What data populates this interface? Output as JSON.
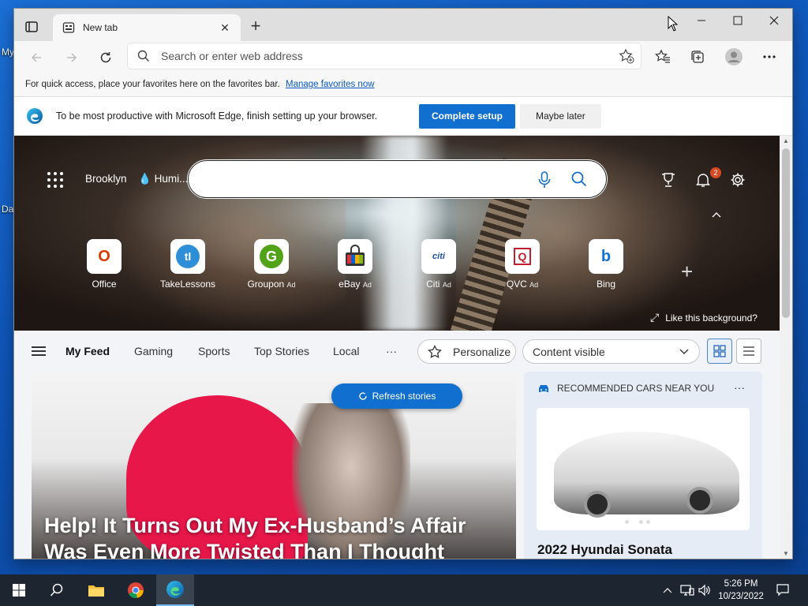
{
  "desktop": {
    "icon_labels": [
      "My",
      "Da"
    ]
  },
  "browser": {
    "tab": {
      "title": "New tab"
    },
    "address": {
      "placeholder": "Search or enter web address"
    },
    "favorites_bar": {
      "text": "For quick access, place your favorites here on the favorites bar.",
      "link": "Manage favorites now"
    },
    "infobar": {
      "message": "To be most productive with Microsoft Edge, finish setting up your browser.",
      "primary": "Complete setup",
      "secondary": "Maybe later"
    }
  },
  "newtab": {
    "location": "Brooklyn",
    "weather": "Humi...",
    "notifications_count": "2",
    "quick_links": [
      {
        "label": "Office",
        "ad": "",
        "color": "#d83b01",
        "glyph": "O"
      },
      {
        "label": "TakeLessons",
        "ad": "",
        "color": "#2e8fd8",
        "glyph": "tl"
      },
      {
        "label": "Groupon",
        "ad": "Ad",
        "color": "#53a318",
        "glyph": "G"
      },
      {
        "label": "eBay",
        "ad": "Ad",
        "color": "#e53238",
        "glyph": "eb"
      },
      {
        "label": "Citi",
        "ad": "Ad",
        "color": "#1b4fa0",
        "glyph": "citi"
      },
      {
        "label": "QVC",
        "ad": "Ad",
        "color": "#c21d2f",
        "glyph": "Q"
      },
      {
        "label": "Bing",
        "ad": "",
        "color": "#0f73d8",
        "glyph": "b"
      }
    ],
    "like_background": "Like this background?",
    "feed_tabs": [
      "My Feed",
      "Gaming",
      "Sports",
      "Top Stories",
      "Local"
    ],
    "more": "···",
    "personalize": "Personalize",
    "content_visible": "Content visible",
    "refresh": "Refresh stories",
    "headline": "Help! It Turns Out My Ex-Husband’s Affair Was Even More Twisted Than I Thought",
    "side_card": {
      "header": "RECOMMENDED CARS NEAR YOU",
      "more": "···",
      "title": "2022 Hyundai Sonata"
    }
  },
  "taskbar": {
    "time": "5:26 PM",
    "date": "10/23/2022"
  }
}
